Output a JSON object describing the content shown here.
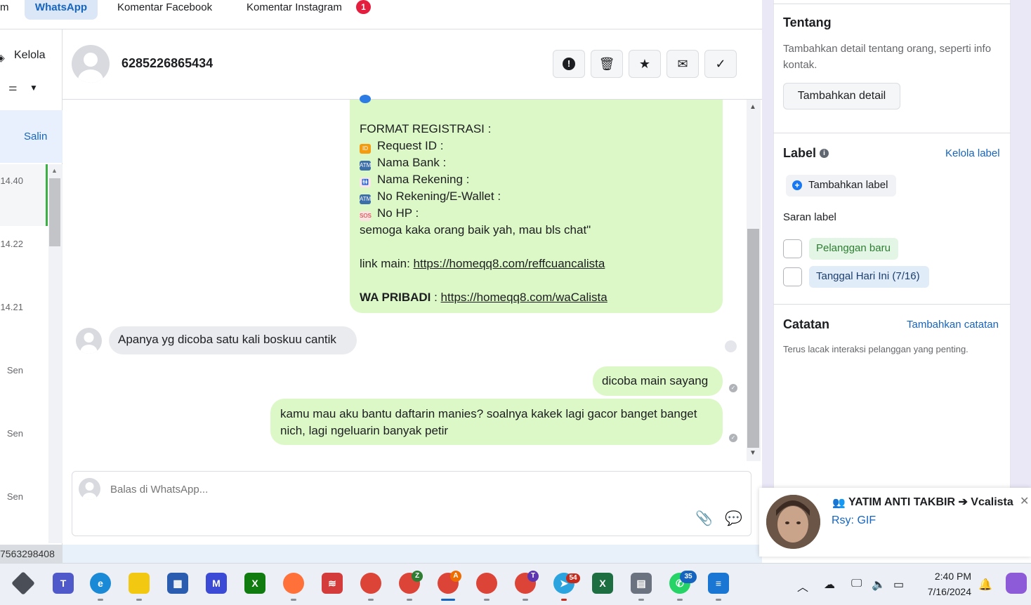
{
  "tabs": {
    "prev_fragment": "m",
    "whatsapp": "WhatsApp",
    "facebook": "Komentar Facebook",
    "instagram": "Komentar Instagram",
    "instagram_badge": "1"
  },
  "left_list": {
    "kelola": "Kelola",
    "salin": "Salin",
    "times": [
      "14.40",
      "14.22",
      "14.21",
      "Sen",
      "Sen",
      "Sen"
    ],
    "id_fragment": "7563298408"
  },
  "chat_header": {
    "phone": "6285226865434",
    "actions": [
      "report-icon",
      "trash-icon",
      "star-icon",
      "envelope-icon",
      "check-icon"
    ]
  },
  "messages": {
    "main": {
      "blank1": "",
      "format_title": "FORMAT REGISTRASI :",
      "request_id": "Request ID :",
      "nama_bank": "Nama Bank :",
      "nama_rekening": "Nama Rekening :",
      "no_rekening": "No Rekening/E-Wallet :",
      "no_hp": "No HP :",
      "closing": "semoga kaka orang baik yah, mau bls chat\"",
      "link_label": "link main: ",
      "link_main": "https://homeqq8.com/reffcuancalista",
      "wa_label": "WA PRIBADI",
      "wa_sep": " : ",
      "wa_link": "https://homeqq8.com/waCalista"
    },
    "incoming": "Apanya yg dicoba satu kali boskuu cantik",
    "outgoing1": "dicoba main sayang",
    "outgoing2": "kamu mau aku bantu daftarin manies? soalnya kakek lagi gacor banget banget nich, lagi ngeluarin banyak petir"
  },
  "composer": {
    "placeholder": "Balas di WhatsApp..."
  },
  "right_panel": {
    "about_title": "Tentang",
    "about_sub": "Tambahkan detail tentang orang, seperti info kontak.",
    "add_detail": "Tambahkan detail",
    "label_title": "Label",
    "manage_label": "Kelola label",
    "add_label": "Tambahkan label",
    "suggest_title": "Saran label",
    "suggest1": "Pelanggan baru",
    "suggest2": "Tanggal Hari Ini (7/16)",
    "notes_title": "Catatan",
    "add_note": "Tambahkan catatan",
    "notes_sub": "Terus lacak interaksi pelanggan yang penting."
  },
  "notification": {
    "title": "YATIM ANTI TAKBIR ➔ Vcalista",
    "message": "Rsy: GIF"
  },
  "taskbar": {
    "badges": {
      "chrome_a": "A",
      "chrome_z": "Z",
      "chrome_t": "T",
      "telegram": "54",
      "whatsapp": "35"
    },
    "time": "2:40 PM",
    "date": "7/16/2024"
  }
}
